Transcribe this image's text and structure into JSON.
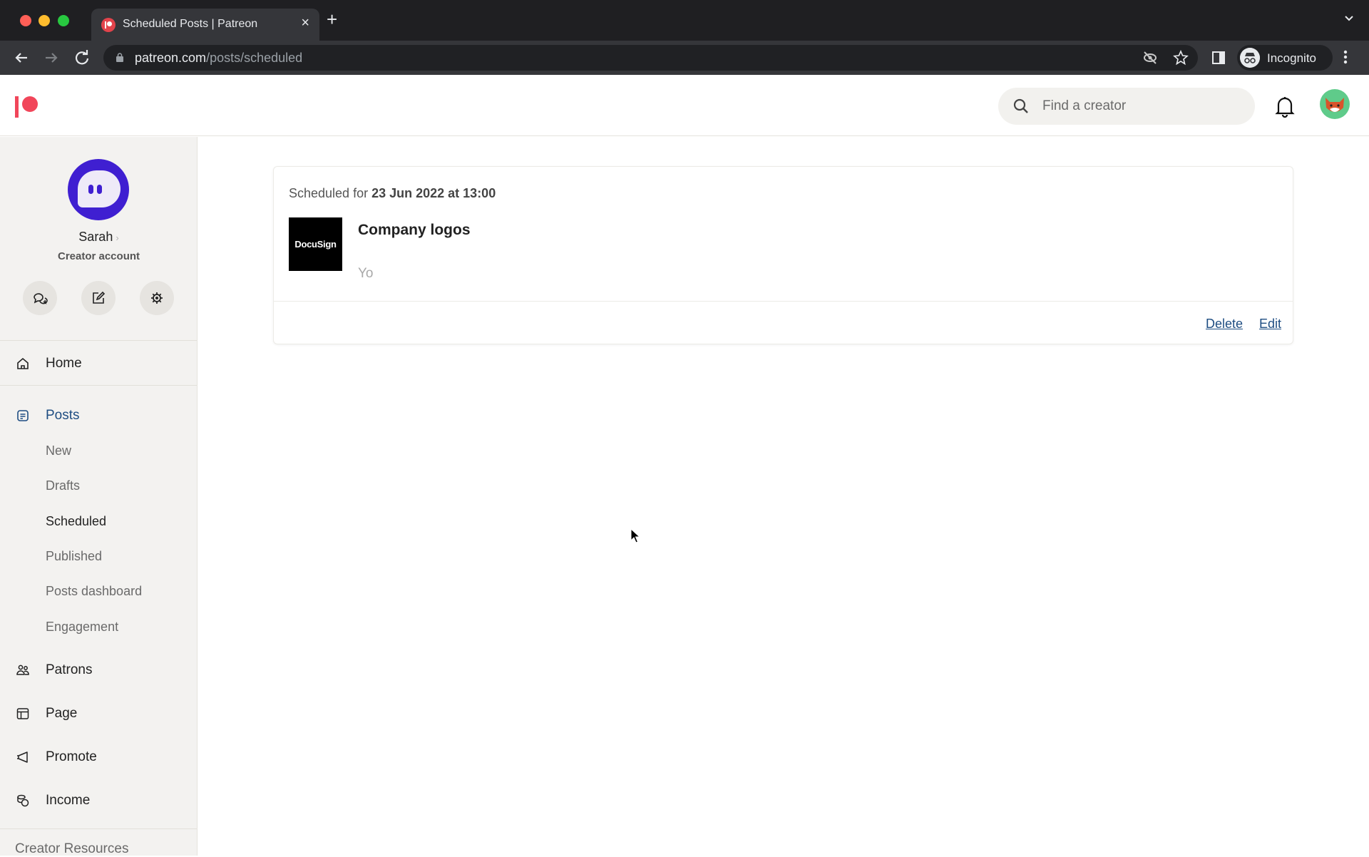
{
  "browser": {
    "tab_title": "Scheduled Posts | Patreon",
    "url_host": "patreon.com",
    "url_path": "/posts/scheduled",
    "profile_label": "Incognito",
    "icons": [
      "back-icon",
      "forward-icon",
      "reload-icon",
      "lock-icon",
      "tracking-off-icon",
      "star-icon",
      "side-panel-icon",
      "incognito-icon",
      "more-icon"
    ]
  },
  "header": {
    "search_placeholder": "Find a creator",
    "brand_color": "#f1465a"
  },
  "sidebar": {
    "profile": {
      "name": "Sarah",
      "role": "Creator account"
    },
    "quick_actions": [
      "messages",
      "new-post",
      "settings"
    ],
    "nav": [
      {
        "label": "Home",
        "icon": "home-icon"
      },
      {
        "label": "Posts",
        "icon": "posts-icon",
        "active": true
      },
      {
        "label": "Patrons",
        "icon": "patrons-icon"
      },
      {
        "label": "Page",
        "icon": "page-icon"
      },
      {
        "label": "Promote",
        "icon": "megaphone-icon"
      },
      {
        "label": "Income",
        "icon": "coins-icon"
      }
    ],
    "posts_sub": [
      "New",
      "Drafts",
      "Scheduled",
      "Published",
      "Posts dashboard",
      "Engagement"
    ],
    "current_sub": "Scheduled",
    "resources_label": "Creator Resources"
  },
  "main": {
    "scheduled_posts": [
      {
        "scheduled_prefix": "Scheduled for",
        "scheduled_at": "23 Jun 2022 at 13:00",
        "thumbnail_text": "DocuSign",
        "title": "Company logos",
        "excerpt": "Yo",
        "actions": {
          "delete": "Delete",
          "edit": "Edit"
        }
      }
    ],
    "link_color": "#1e4d82"
  }
}
